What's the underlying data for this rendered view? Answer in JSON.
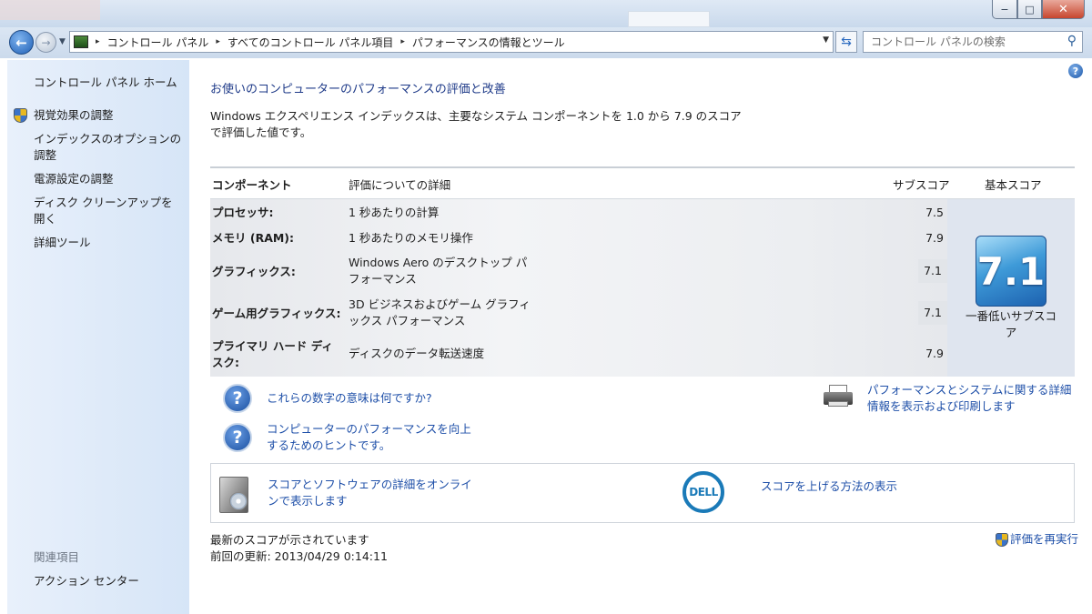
{
  "address": {
    "crumbs": [
      "コントロール パネル",
      "すべてのコントロール パネル項目",
      "パフォーマンスの情報とツール"
    ],
    "separator": "▸",
    "search_placeholder": "コントロール パネルの検索"
  },
  "window_controls": {
    "minimize": "−",
    "maximize": "□",
    "close": "✕"
  },
  "sidebar": {
    "home": "コントロール パネル ホーム",
    "items": [
      "視覚効果の調整",
      "インデックスのオプションの調整",
      "電源設定の調整",
      "ディスク クリーンアップを開く",
      "詳細ツール"
    ],
    "related_heading": "関連項目",
    "related_items": [
      "アクション センター"
    ]
  },
  "main": {
    "heading": "お使いのコンピューターのパフォーマンスの評価と改善",
    "intro": "Windows エクスペリエンス インデックスは、主要なシステム コンポーネントを 1.0 から 7.9 のスコアで評価した値です。",
    "table": {
      "headers": {
        "component": "コンポーネント",
        "detail": "評価についての詳細",
        "subscore": "サブスコア",
        "basescore": "基本スコア"
      },
      "rows": [
        {
          "component": "プロセッサ:",
          "detail": "1 秒あたりの計算",
          "subscore": "7.5"
        },
        {
          "component": "メモリ (RAM):",
          "detail": "1 秒あたりのメモリ操作",
          "subscore": "7.9"
        },
        {
          "component": "グラフィックス:",
          "detail": "Windows Aero のデスクトップ パフォーマンス",
          "subscore": "7.1"
        },
        {
          "component": "ゲーム用グラフィックス:",
          "detail": "3D ビジネスおよびゲーム グラフィックス パフォーマンス",
          "subscore": "7.1"
        },
        {
          "component": "プライマリ ハード ディスク:",
          "detail": "ディスクのデータ転送速度",
          "subscore": "7.9"
        }
      ],
      "base_score": "7.1",
      "base_score_label": "一番低いサブスコア"
    },
    "links": {
      "meaning": "これらの数字の意味は何ですか?",
      "tips": "コンピューターのパフォーマンスを向上するためのヒントです。",
      "print": "パフォーマンスとシステムに関する詳細情報を表示および印刷します",
      "online": "スコアとソフトウェアの詳細をオンラインで表示します",
      "improve": "スコアを上げる方法の表示"
    },
    "dell_logo": "DELL",
    "status": "最新のスコアが示されています",
    "last_updated": "前回の更新: 2013/04/29 0:14:11",
    "rerun": "評価を再実行"
  },
  "colors": {
    "link": "#1e4fa8",
    "heading": "#1e3a88",
    "sidebar_bg": "#dbe7f7",
    "score_tile": "#3e9ad8"
  }
}
